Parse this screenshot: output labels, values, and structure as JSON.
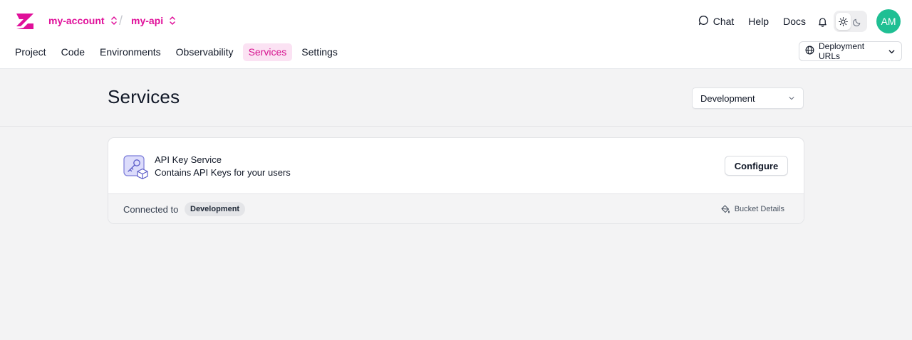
{
  "app": {
    "brand_color": "#e0109a",
    "logo_icon": "zuplo-z-logo"
  },
  "breadcrumb": {
    "account": "my-account",
    "separator": "/",
    "project": "my-api"
  },
  "header_actions": {
    "chat": "Chat",
    "help": "Help",
    "docs": "Docs",
    "theme_selected": "light",
    "avatar_initials": "AM",
    "avatar_color": "#1fbf93"
  },
  "nav": {
    "tabs": [
      {
        "label": "Project",
        "active": false
      },
      {
        "label": "Code",
        "active": false
      },
      {
        "label": "Environments",
        "active": false
      },
      {
        "label": "Observability",
        "active": false
      },
      {
        "label": "Services",
        "active": true
      },
      {
        "label": "Settings",
        "active": false
      }
    ],
    "deployment_urls_label": "Deployment URLs"
  },
  "page": {
    "title": "Services",
    "environment_selected": "Development"
  },
  "services": [
    {
      "name": "API Key Service",
      "description": "Contains API Keys for your users",
      "configure_label": "Configure",
      "connected_label": "Connected to",
      "connected_environment": "Development",
      "bucket_link_label": "Bucket Details"
    }
  ]
}
